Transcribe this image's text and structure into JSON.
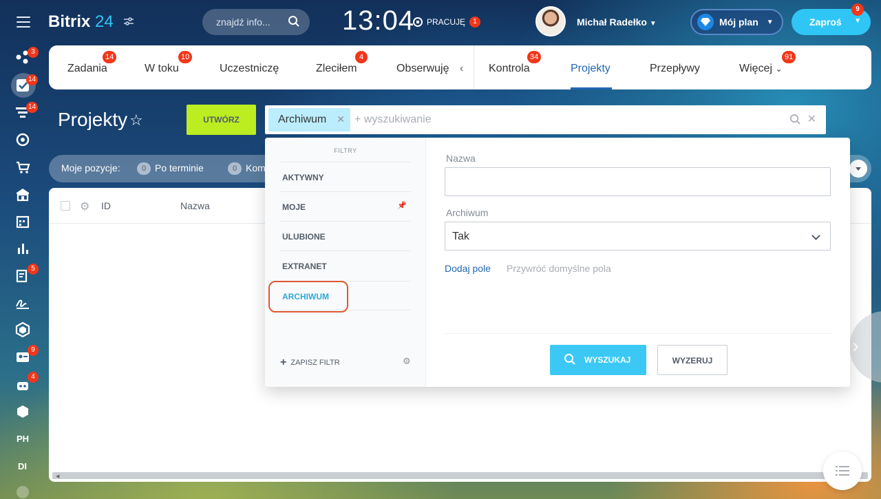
{
  "topbar": {
    "logo_word": "Bitrix",
    "logo_num": "24",
    "search_placeholder": "znajdź info...",
    "clock": "13:04",
    "work_status": "PRACUJĘ",
    "work_badge": "1",
    "user_name": "Michał Radełko",
    "plan_label": "Mój plan",
    "invite_label": "Zaproś",
    "invite_badge": "9"
  },
  "rail": {
    "badges": [
      "3",
      "14",
      "14",
      "5",
      "9",
      "4"
    ],
    "text_items": [
      "PH",
      "DI"
    ]
  },
  "tabs": [
    {
      "label": "Zadania",
      "badge": "14"
    },
    {
      "label": "W toku",
      "badge": "10"
    },
    {
      "label": "Uczestniczę",
      "badge": ""
    },
    {
      "label": "Zleciłem",
      "badge": "4"
    },
    {
      "label": "Obserwuję",
      "badge": ""
    },
    {
      "label": "Kontrola",
      "badge": "34"
    },
    {
      "label": "Projekty",
      "badge": ""
    },
    {
      "label": "Przepływy",
      "badge": ""
    },
    {
      "label": "Więcej",
      "badge": "91"
    }
  ],
  "page": {
    "title": "Projekty",
    "create_label": "UTWÓRZ",
    "filter_chip": "Archiwum",
    "filter_placeholder": "+ wyszukiwanie"
  },
  "counters": {
    "label": "Moje pozycje:",
    "items": [
      {
        "count": "0",
        "label": "Po terminie"
      },
      {
        "count": "0",
        "label": "Kom"
      }
    ]
  },
  "grid": {
    "columns": [
      "ID",
      "Nazwa"
    ]
  },
  "filter_popup": {
    "title": "FILTRY",
    "presets": [
      "AKTYWNY",
      "MOJE",
      "ULUBIONE",
      "EXTRANET",
      "ARCHIWUM"
    ],
    "active_preset": "ARCHIWUM",
    "save_filter": "ZAPISZ FILTR",
    "fields": {
      "name_label": "Nazwa",
      "name_value": "",
      "archive_label": "Archiwum",
      "archive_value": "Tak"
    },
    "add_field": "Dodaj pole",
    "restore_fields": "Przywróć domyślne pola",
    "search_button": "WYSZUKAJ",
    "reset_button": "WYZERUJ"
  },
  "colors": {
    "accent": "#2fc6f6",
    "create": "#bbed21",
    "badge": "#f0371b",
    "highlight": "#e0572e"
  }
}
